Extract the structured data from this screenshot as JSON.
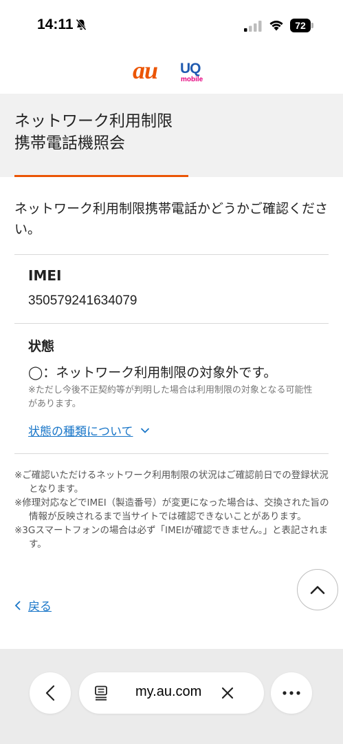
{
  "status_bar": {
    "time": "14:11",
    "battery": "72"
  },
  "header": {
    "logo_primary": "au",
    "logo_secondary": "UQ",
    "logo_secondary_sub": "mobile"
  },
  "page": {
    "title": "ネットワーク利用制限\n携帯電話機照会",
    "intro": "ネットワーク利用制限携帯電話かどうかご確認ください。"
  },
  "result": {
    "imei_label": "IMEI",
    "imei_value": "350579241634079",
    "status_label": "状態",
    "status_value": "◯：ネットワーク利用制限の対象外です。",
    "status_note": "※ただし今後不正契約等が判明した場合は利用制限の対象となる可能性があります。",
    "status_link": "状態の種類について"
  },
  "notes": [
    "※ご確認いただけるネットワーク利用制限の状況はご確認前日での登録状況となります。",
    "※修理対応などでIMEI（製造番号）が変更になった場合は、交換された旨の情報が反映されるまで当サイトでは確認できないことがあります。",
    "※3Gスマートフォンの場合は必ず「IMEIが確認できません。」と表記されます。"
  ],
  "back_label": "戻る",
  "browser": {
    "url": "my.au.com"
  },
  "colors": {
    "accent": "#eb5505",
    "link": "#1976c8",
    "uq_blue": "#1f5ab0",
    "uq_pink": "#e5007f"
  },
  "icons": {
    "bell": "bell-slash-icon",
    "signal": "signal-icon",
    "wifi": "wifi-icon",
    "scroll_top": "chevron-up-icon",
    "back": "chevron-left-icon",
    "reader": "reader-icon",
    "close": "close-icon",
    "more": "more-icon"
  }
}
